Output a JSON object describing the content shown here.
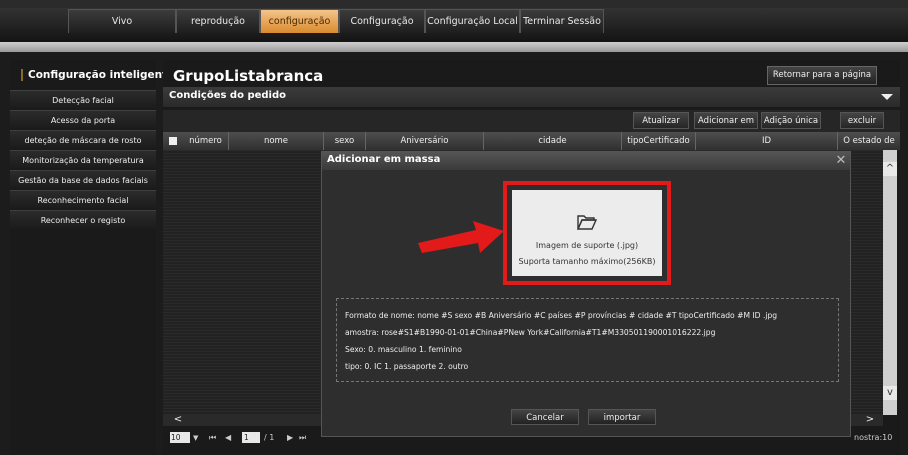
{
  "nav": {
    "tabs": [
      {
        "label": "Vivo",
        "active": false
      },
      {
        "label": "reprodução",
        "active": false
      },
      {
        "label": "configuração",
        "active": true
      },
      {
        "label": "Configuração",
        "active": false
      },
      {
        "label": "Configuração Local",
        "active": false
      },
      {
        "label": "Terminar Sessão",
        "active": false
      }
    ]
  },
  "sidebar": {
    "title": "Configuração inteligente",
    "icon": "monitor-icon",
    "items": [
      {
        "label": "Detecção facial"
      },
      {
        "label": "Acesso da porta"
      },
      {
        "label": "deteção de máscara de rosto"
      },
      {
        "label": "Monitorização da temperatura"
      },
      {
        "label": "Gestão da base de dados faciais"
      },
      {
        "label": "Reconhecimento facial"
      },
      {
        "label": "Reconhecer o registo"
      }
    ]
  },
  "main": {
    "title": "GrupoListabranca",
    "return_label": "Retornar para a página",
    "conditions_title": "Condições do pedido",
    "toolbar": {
      "refresh": "Atualizar",
      "bulk_add": "Adicionar em",
      "single_add": "Adição única",
      "delete": "excluir"
    },
    "table": {
      "columns": [
        "número",
        "nome",
        "sexo",
        "Aniversário",
        "cidade",
        "tipoCertificado",
        "ID",
        "O estado de"
      ]
    },
    "pager": {
      "page_size": "10",
      "first": "⏮",
      "prev": "◀",
      "current": "1",
      "total": "/ 1",
      "next": "▶",
      "last": "⏭",
      "sample_label": "nostra:10"
    }
  },
  "modal": {
    "title": "Adicionar em massa",
    "close_glyph": "✕",
    "upload": {
      "line1": "Imagem de suporte (.jpg)",
      "line2": "Suporta tamanho máximo(256KB)"
    },
    "info": {
      "format": "Formato de nome:  nome #S sexo #B Aniversário #C países #P províncias # cidade #T tipoCertificado #M ID .jpg",
      "sample": "amostra:  rose#S1#B1990-01-01#China#PNew York#California#T1#M330501190001016222.jpg",
      "sex": "Sexo:  0. masculino 1. feminino",
      "type": "tipo:  0. IC 1. passaporte 2. outro"
    },
    "cancel": "Cancelar",
    "import": "importar"
  },
  "colors": {
    "active_tab": "#e0963a",
    "highlight": "#e21a1a"
  }
}
